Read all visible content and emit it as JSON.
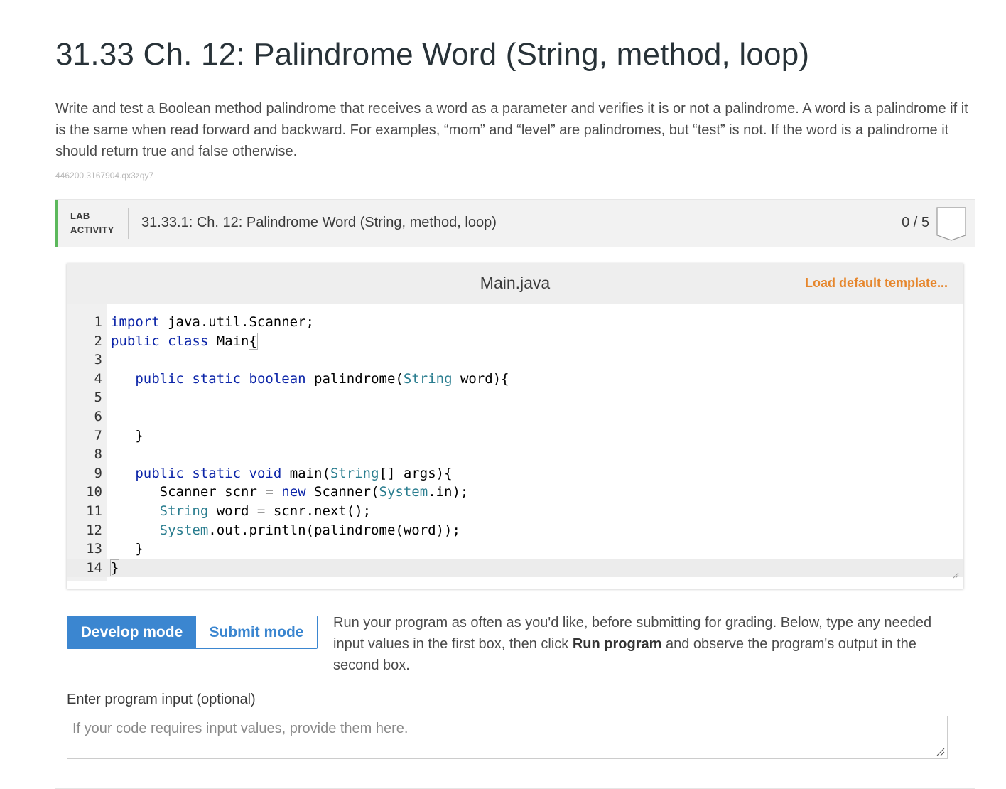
{
  "page": {
    "title": "31.33 Ch. 12: Palindrome Word (String, method, loop)",
    "description": "Write and test a Boolean method palindrome that receives a word as a parameter and verifies it is or not a palindrome. A word is a palindrome if it is the same when read forward and backward. For examples, “mom” and “level” are palindromes, but “test” is not. If the word is a palindrome it should return true and false otherwise.",
    "ref_id": "446200.3167904.qx3zqy7"
  },
  "lab": {
    "label_line1": "LAB",
    "label_line2": "ACTIVITY",
    "title": "31.33.1: Ch. 12: Palindrome Word (String, method, loop)",
    "score": "0 / 5",
    "accent_color": "#5cb85c"
  },
  "editor": {
    "file_name": "Main.java",
    "load_template_label": "Load default template...",
    "active_line": 14,
    "lines": [
      {
        "num": "1",
        "text": "import java.util.Scanner;"
      },
      {
        "num": "2",
        "text": "public class Main{"
      },
      {
        "num": "3",
        "text": ""
      },
      {
        "num": "4",
        "text": "   public static boolean palindrome(String word){"
      },
      {
        "num": "5",
        "text": ""
      },
      {
        "num": "6",
        "text": ""
      },
      {
        "num": "7",
        "text": "   }"
      },
      {
        "num": "8",
        "text": ""
      },
      {
        "num": "9",
        "text": "   public static void main(String[] args){"
      },
      {
        "num": "10",
        "text": "      Scanner scnr = new Scanner(System.in);"
      },
      {
        "num": "11",
        "text": "      String word = scnr.next();"
      },
      {
        "num": "12",
        "text": "      System.out.println(palindrome(word));"
      },
      {
        "num": "13",
        "text": "   }"
      },
      {
        "num": "14",
        "text": "}"
      }
    ]
  },
  "modes": {
    "develop_label": "Develop mode",
    "submit_label": "Submit mode",
    "selected": "develop"
  },
  "run_help": {
    "part1": "Run your program as often as you'd like, before submitting for grading. Below, type any needed input values in the first box, then click ",
    "bold": "Run program",
    "part2": " and observe the program's output in the second box."
  },
  "program_input": {
    "label": "Enter program input (optional)",
    "placeholder": "If your code requires input values, provide them here.",
    "value": ""
  },
  "colors": {
    "accent_blue": "#3b86d0",
    "link_orange": "#e6862c",
    "keyword": "#0b24a8",
    "type": "#2a7d8f"
  }
}
